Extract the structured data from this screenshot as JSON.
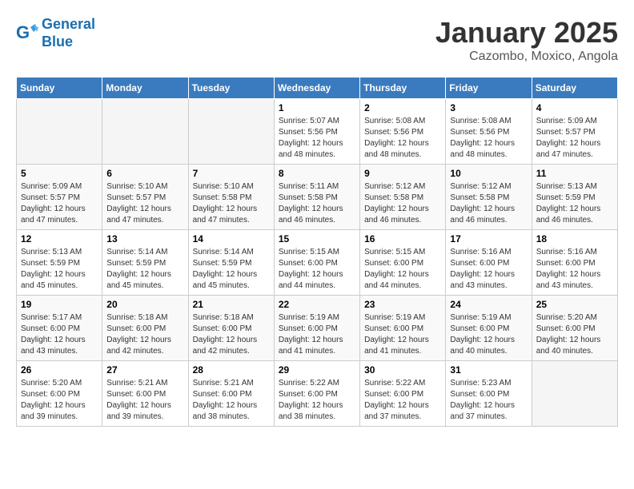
{
  "header": {
    "logo_line1": "General",
    "logo_line2": "Blue",
    "month": "January 2025",
    "location": "Cazombo, Moxico, Angola"
  },
  "weekdays": [
    "Sunday",
    "Monday",
    "Tuesday",
    "Wednesday",
    "Thursday",
    "Friday",
    "Saturday"
  ],
  "weeks": [
    [
      {
        "day": "",
        "info": ""
      },
      {
        "day": "",
        "info": ""
      },
      {
        "day": "",
        "info": ""
      },
      {
        "day": "1",
        "info": "Sunrise: 5:07 AM\nSunset: 5:56 PM\nDaylight: 12 hours\nand 48 minutes."
      },
      {
        "day": "2",
        "info": "Sunrise: 5:08 AM\nSunset: 5:56 PM\nDaylight: 12 hours\nand 48 minutes."
      },
      {
        "day": "3",
        "info": "Sunrise: 5:08 AM\nSunset: 5:56 PM\nDaylight: 12 hours\nand 48 minutes."
      },
      {
        "day": "4",
        "info": "Sunrise: 5:09 AM\nSunset: 5:57 PM\nDaylight: 12 hours\nand 47 minutes."
      }
    ],
    [
      {
        "day": "5",
        "info": "Sunrise: 5:09 AM\nSunset: 5:57 PM\nDaylight: 12 hours\nand 47 minutes."
      },
      {
        "day": "6",
        "info": "Sunrise: 5:10 AM\nSunset: 5:57 PM\nDaylight: 12 hours\nand 47 minutes."
      },
      {
        "day": "7",
        "info": "Sunrise: 5:10 AM\nSunset: 5:58 PM\nDaylight: 12 hours\nand 47 minutes."
      },
      {
        "day": "8",
        "info": "Sunrise: 5:11 AM\nSunset: 5:58 PM\nDaylight: 12 hours\nand 46 minutes."
      },
      {
        "day": "9",
        "info": "Sunrise: 5:12 AM\nSunset: 5:58 PM\nDaylight: 12 hours\nand 46 minutes."
      },
      {
        "day": "10",
        "info": "Sunrise: 5:12 AM\nSunset: 5:58 PM\nDaylight: 12 hours\nand 46 minutes."
      },
      {
        "day": "11",
        "info": "Sunrise: 5:13 AM\nSunset: 5:59 PM\nDaylight: 12 hours\nand 46 minutes."
      }
    ],
    [
      {
        "day": "12",
        "info": "Sunrise: 5:13 AM\nSunset: 5:59 PM\nDaylight: 12 hours\nand 45 minutes."
      },
      {
        "day": "13",
        "info": "Sunrise: 5:14 AM\nSunset: 5:59 PM\nDaylight: 12 hours\nand 45 minutes."
      },
      {
        "day": "14",
        "info": "Sunrise: 5:14 AM\nSunset: 5:59 PM\nDaylight: 12 hours\nand 45 minutes."
      },
      {
        "day": "15",
        "info": "Sunrise: 5:15 AM\nSunset: 6:00 PM\nDaylight: 12 hours\nand 44 minutes."
      },
      {
        "day": "16",
        "info": "Sunrise: 5:15 AM\nSunset: 6:00 PM\nDaylight: 12 hours\nand 44 minutes."
      },
      {
        "day": "17",
        "info": "Sunrise: 5:16 AM\nSunset: 6:00 PM\nDaylight: 12 hours\nand 43 minutes."
      },
      {
        "day": "18",
        "info": "Sunrise: 5:16 AM\nSunset: 6:00 PM\nDaylight: 12 hours\nand 43 minutes."
      }
    ],
    [
      {
        "day": "19",
        "info": "Sunrise: 5:17 AM\nSunset: 6:00 PM\nDaylight: 12 hours\nand 43 minutes."
      },
      {
        "day": "20",
        "info": "Sunrise: 5:18 AM\nSunset: 6:00 PM\nDaylight: 12 hours\nand 42 minutes."
      },
      {
        "day": "21",
        "info": "Sunrise: 5:18 AM\nSunset: 6:00 PM\nDaylight: 12 hours\nand 42 minutes."
      },
      {
        "day": "22",
        "info": "Sunrise: 5:19 AM\nSunset: 6:00 PM\nDaylight: 12 hours\nand 41 minutes."
      },
      {
        "day": "23",
        "info": "Sunrise: 5:19 AM\nSunset: 6:00 PM\nDaylight: 12 hours\nand 41 minutes."
      },
      {
        "day": "24",
        "info": "Sunrise: 5:19 AM\nSunset: 6:00 PM\nDaylight: 12 hours\nand 40 minutes."
      },
      {
        "day": "25",
        "info": "Sunrise: 5:20 AM\nSunset: 6:00 PM\nDaylight: 12 hours\nand 40 minutes."
      }
    ],
    [
      {
        "day": "26",
        "info": "Sunrise: 5:20 AM\nSunset: 6:00 PM\nDaylight: 12 hours\nand 39 minutes."
      },
      {
        "day": "27",
        "info": "Sunrise: 5:21 AM\nSunset: 6:00 PM\nDaylight: 12 hours\nand 39 minutes."
      },
      {
        "day": "28",
        "info": "Sunrise: 5:21 AM\nSunset: 6:00 PM\nDaylight: 12 hours\nand 38 minutes."
      },
      {
        "day": "29",
        "info": "Sunrise: 5:22 AM\nSunset: 6:00 PM\nDaylight: 12 hours\nand 38 minutes."
      },
      {
        "day": "30",
        "info": "Sunrise: 5:22 AM\nSunset: 6:00 PM\nDaylight: 12 hours\nand 37 minutes."
      },
      {
        "day": "31",
        "info": "Sunrise: 5:23 AM\nSunset: 6:00 PM\nDaylight: 12 hours\nand 37 minutes."
      },
      {
        "day": "",
        "info": ""
      }
    ]
  ]
}
